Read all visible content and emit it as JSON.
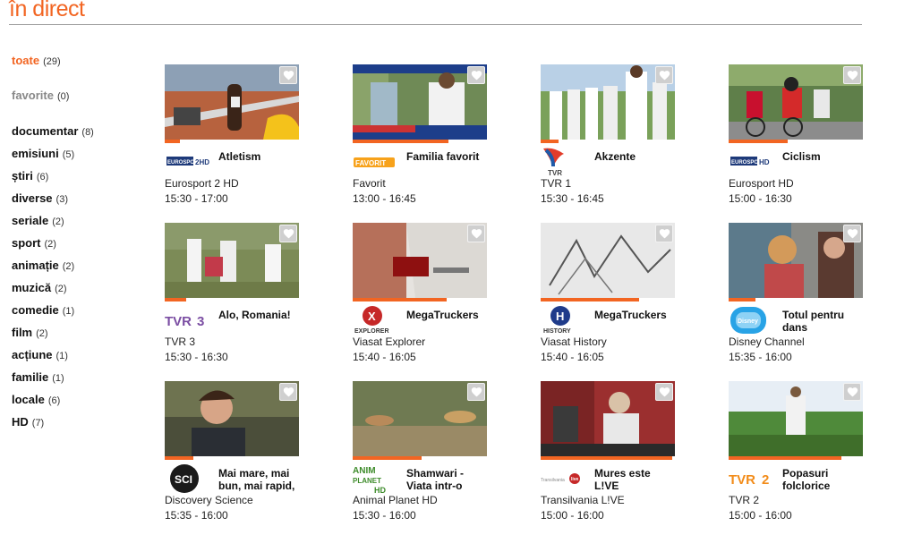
{
  "header": {
    "title": "în direct"
  },
  "sidebar": {
    "items": [
      {
        "label": "toate",
        "count": "(29)",
        "state": "active"
      },
      {
        "label": "favorite",
        "count": "(0)",
        "state": "muted"
      },
      {
        "label": "documentar",
        "count": "(8)",
        "state": "normal"
      },
      {
        "label": "emisiuni",
        "count": "(5)",
        "state": "normal"
      },
      {
        "label": "știri",
        "count": "(6)",
        "state": "normal"
      },
      {
        "label": "diverse",
        "count": "(3)",
        "state": "normal"
      },
      {
        "label": "seriale",
        "count": "(2)",
        "state": "normal"
      },
      {
        "label": "sport",
        "count": "(2)",
        "state": "normal"
      },
      {
        "label": "animație",
        "count": "(2)",
        "state": "normal"
      },
      {
        "label": "muzică",
        "count": "(2)",
        "state": "normal"
      },
      {
        "label": "comedie",
        "count": "(1)",
        "state": "normal"
      },
      {
        "label": "film",
        "count": "(2)",
        "state": "normal"
      },
      {
        "label": "acțiune",
        "count": "(1)",
        "state": "normal"
      },
      {
        "label": "familie",
        "count": "(1)",
        "state": "normal"
      },
      {
        "label": "locale",
        "count": "(6)",
        "state": "normal"
      },
      {
        "label": "HD",
        "count": "(7)",
        "state": "normal"
      }
    ]
  },
  "colors": {
    "accent": "#f26522",
    "muted": "#888888",
    "fav_bg": "#cfcfcf"
  },
  "programs": [
    {
      "show": "Atletism",
      "channel": "Eurosport 2 HD",
      "time": "15:30 - 17:00",
      "progress": 0.11,
      "logo": "Eurosport 2 HD",
      "logo_icon": "eurosport-2-hd-logo"
    },
    {
      "show": "Familia favorit",
      "channel": "Favorit",
      "time": "13:00 - 16:45",
      "progress": 0.71,
      "logo": "FAVORIT",
      "logo_icon": "favorit-logo"
    },
    {
      "show": "Akzente",
      "channel": "TVR 1",
      "time": "15:30 - 16:45",
      "progress": 0.13,
      "logo": "TVR",
      "logo_icon": "tvr1-logo"
    },
    {
      "show": "Ciclism",
      "channel": "Eurosport HD",
      "time": "15:00 - 16:30",
      "progress": 0.44,
      "logo": "Eurosport HD",
      "logo_icon": "eurosport-hd-logo"
    },
    {
      "show": "Alo, Romania!",
      "channel": "TVR 3",
      "time": "15:30 - 16:30",
      "progress": 0.16,
      "logo": "TVR3",
      "logo_icon": "tvr3-logo"
    },
    {
      "show": "MegaTruckers",
      "channel": "Viasat Explorer",
      "time": "15:40 - 16:05",
      "progress": 0.7,
      "logo": "EXPLORER",
      "logo_icon": "viasat-explorer-logo"
    },
    {
      "show": "MegaTruckers",
      "channel": "Viasat History",
      "time": "15:40 - 16:05",
      "progress": 0.73,
      "logo": "HISTORY",
      "logo_icon": "viasat-history-logo"
    },
    {
      "show": "Totul pentru dans",
      "channel": "Disney Channel",
      "time": "15:35 - 16:00",
      "progress": 0.2,
      "logo": "Disney Channel",
      "logo_icon": "disney-channel-logo"
    },
    {
      "show": "Mai mare, mai bun, mai rapid,",
      "channel": "Discovery Science",
      "time": "15:35 - 16:00",
      "progress": 0.21,
      "logo": "SCI",
      "logo_icon": "discovery-science-logo"
    },
    {
      "show": "Shamwari - Viata intr-o",
      "channel": "Animal Planet HD",
      "time": "15:30 - 16:00",
      "progress": 0.51,
      "logo": "ANIMAL PLANET HD",
      "logo_icon": "animal-planet-hd-logo"
    },
    {
      "show": "Mures este L!VE",
      "channel": "Transilvania L!VE",
      "time": "15:00 - 16:00",
      "progress": 0.98,
      "logo": "Transilvania Live",
      "logo_icon": "transilvania-live-logo"
    },
    {
      "show": "Popasuri folclorice",
      "channel": "TVR 2",
      "time": "15:00 - 16:00",
      "progress": 0.84,
      "logo": "TVR2",
      "logo_icon": "tvr2-logo"
    }
  ]
}
